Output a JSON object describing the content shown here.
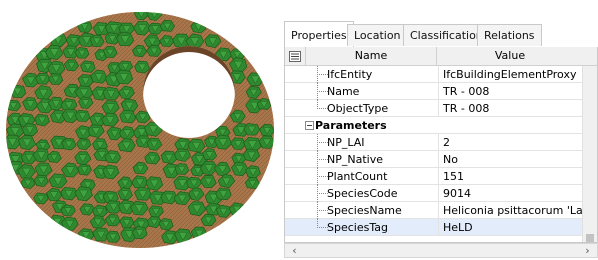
{
  "tabs": [
    {
      "label": "Properties"
    },
    {
      "label": "Location"
    },
    {
      "label": "Classification"
    },
    {
      "label": "Relations"
    }
  ],
  "grid": {
    "header": {
      "name": "Name",
      "value": "Value"
    },
    "rows": [
      {
        "name": "IfcEntity",
        "value": "IfcBuildingElementProxy"
      },
      {
        "name": "Name",
        "value": "TR - 008"
      },
      {
        "name": "ObjectType",
        "value": "TR - 008"
      },
      {
        "name": "Parameters",
        "value": ""
      },
      {
        "name": "NP_LAI",
        "value": "2"
      },
      {
        "name": "NP_Native",
        "value": "No"
      },
      {
        "name": "PlantCount",
        "value": "151"
      },
      {
        "name": "SpeciesCode",
        "value": "9014"
      },
      {
        "name": "SpeciesName",
        "value": "Heliconia psittacorum 'Lady Di'"
      },
      {
        "name": "SpeciesTag",
        "value": "HeLD"
      }
    ]
  },
  "colors": {
    "plant_green": "#2f8a2f",
    "plant_dark": "#1f5f1f",
    "soil_brown": "#a8764a",
    "selection": "#e3ecfb"
  },
  "icons": {
    "sort": "categorized-sort-icon",
    "scroll_left": "arrow-left-icon",
    "scroll_right": "arrow-right-icon"
  }
}
